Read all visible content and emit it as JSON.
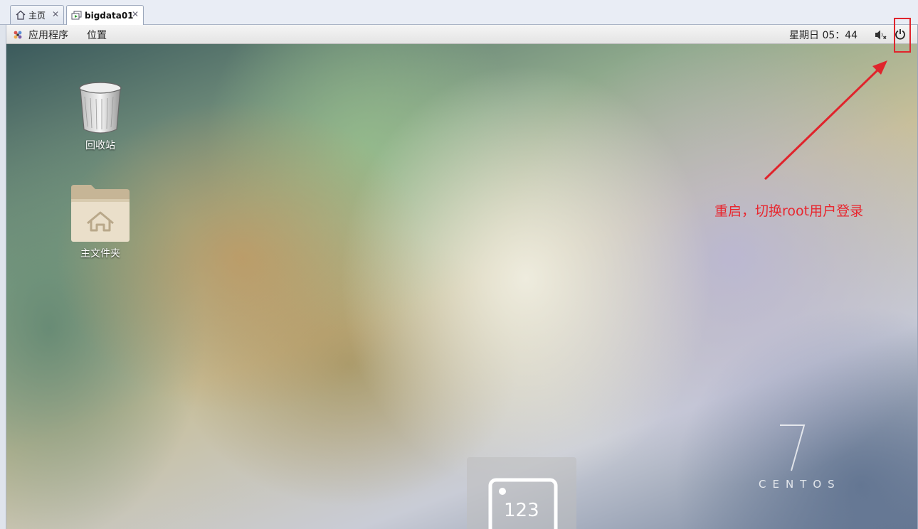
{
  "tabs": [
    {
      "label": "主页",
      "icon": "home-icon",
      "close": "✕"
    },
    {
      "label": "bigdata01",
      "icon": "vm-icon",
      "close": "✕"
    }
  ],
  "topbar": {
    "applications": "应用程序",
    "places": "位置",
    "datetime": "星期日 05：44",
    "volume_icon": "volume-muted-icon",
    "power_icon": "power-icon"
  },
  "desktop": {
    "trash_label": "回收站",
    "home_folder_label": "主文件夹",
    "keyboard_layout": "123",
    "logo_number": "7",
    "logo_text": "CENTOS"
  },
  "annotation": {
    "text": "重启，切换root用户登录",
    "color": "#e8262e"
  }
}
